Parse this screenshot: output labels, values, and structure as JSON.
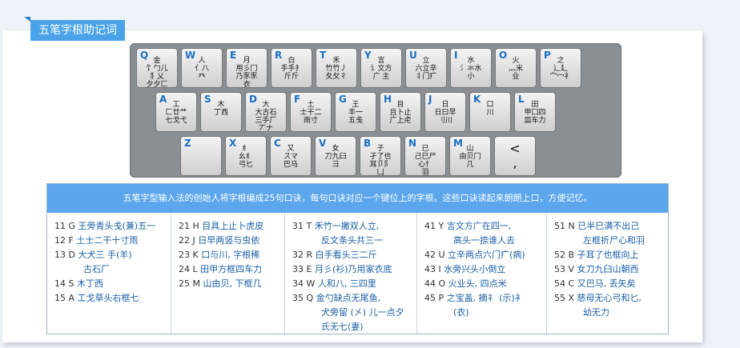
{
  "title": "五笔字根助记词",
  "keyboard": {
    "rows": [
      [
        {
          "letter": "Q",
          "caption": "金\n饣勹儿\n犭乂\n夕夕匚"
        },
        {
          "letter": "W",
          "caption": "人\n亻八\n癶"
        },
        {
          "letter": "E",
          "caption": "月\n用彡冂\n乃豕豕\n衣"
        },
        {
          "letter": "R",
          "caption": "白\n手手扌\n斤斤"
        },
        {
          "letter": "T",
          "caption": "禾\n竹竹丿\n夂攵彳"
        },
        {
          "letter": "Y",
          "caption": "言\n讠文方\n广 主"
        },
        {
          "letter": "U",
          "caption": "立\n六立辛\n丬门疒"
        },
        {
          "letter": "I",
          "caption": "水\n氵氺水\n小"
        },
        {
          "letter": "O",
          "caption": "火\n灬米\n业"
        },
        {
          "letter": "P",
          "caption": "之\n辶廴\n宀冖礻"
        }
      ],
      [
        {
          "letter": "A",
          "caption": "工\n匚廿艹\n七戈弋"
        },
        {
          "letter": "S",
          "caption": "木\n丁西"
        },
        {
          "letter": "D",
          "caption": "大\n大古石\n三手厂\n丆ナ"
        },
        {
          "letter": "F",
          "caption": "土\n士干二\n雨寸"
        },
        {
          "letter": "G",
          "caption": "王\n丰一\n五戋"
        },
        {
          "letter": "H",
          "caption": "目\n且卜止\n广上虍"
        },
        {
          "letter": "J",
          "caption": "日\n日曰早\n刂川"
        },
        {
          "letter": "K",
          "caption": "口\n川"
        },
        {
          "letter": "L",
          "caption": "田\n甲囗四\n皿车力"
        }
      ],
      [
        {
          "letter": "Z",
          "caption": ""
        },
        {
          "letter": "X",
          "caption": "纟\n幺纟\n弓匕"
        },
        {
          "letter": "C",
          "caption": "又\nスマ\n巴马"
        },
        {
          "letter": "V",
          "caption": "女\n刀九臼\n彐"
        },
        {
          "letter": "B",
          "caption": "子\n孑了也\n耳卩阝\n凵"
        },
        {
          "letter": "N",
          "caption": "已\n己巳尸\n心忄\n羽"
        },
        {
          "letter": "M",
          "caption": "山\n由贝冂\n几"
        },
        {
          "letter": "",
          "caption": "<\n,"
        }
      ]
    ]
  },
  "info": {
    "header": "五笔字型输入法的创始人将字根编成25句口诀，每句口诀对应一个键位上的字根。这些口诀读起来朗朗上口，方便记忆。",
    "columns": [
      [
        {
          "num": "11 G",
          "text": "王旁青头戋(兼)五一"
        },
        {
          "num": "12 F",
          "text": "土士二干十寸雨"
        },
        {
          "num": "13 D",
          "text": "大犬三 手(羊)"
        },
        {
          "num": "",
          "text": "古石厂"
        },
        {
          "num": "14 S",
          "text": "木丁西"
        },
        {
          "num": "15 A",
          "text": "工戈草头右框七"
        }
      ],
      [
        {
          "num": "21 H",
          "text": "目具上止卜虎皮"
        },
        {
          "num": "22 J",
          "text": "日早两竖与虫依"
        },
        {
          "num": "23 K",
          "text": "口与川, 字根稀"
        },
        {
          "num": "24 L",
          "text": "田甲方框四车力"
        },
        {
          "num": "25 M",
          "text": "山由贝, 下框几"
        }
      ],
      [
        {
          "num": "31 T",
          "text": "禾竹一撇双人立,"
        },
        {
          "num": "",
          "text": "反文条头共三一"
        },
        {
          "num": "32 R",
          "text": "白手看头三二斤"
        },
        {
          "num": "33 E",
          "text": "月彡(衫)乃用家衣底"
        },
        {
          "num": "34 W",
          "text": "人和八, 三四里"
        },
        {
          "num": "35 Q",
          "text": "金勺缺点无尾鱼,"
        },
        {
          "num": "",
          "text": "犬旁留 (㐅) 儿一点夕"
        },
        {
          "num": "",
          "text": "氏无七(妻)"
        }
      ],
      [
        {
          "num": "41 Y",
          "text": "言文方广在四一,"
        },
        {
          "num": "",
          "text": "高头一捺谁人去"
        },
        {
          "num": "42 U",
          "text": "立辛两点六门疒(病)"
        },
        {
          "num": "43 I",
          "text": "水旁兴头小倒立"
        },
        {
          "num": "44 O",
          "text": "火业头, 四点米"
        },
        {
          "num": "45 P",
          "text": "之宝盖, 摘礻 (示)衤"
        },
        {
          "num": "",
          "text": "(衣)"
        }
      ],
      [
        {
          "num": "51 N",
          "text": "已半巳满不出己"
        },
        {
          "num": "",
          "text": "左框折尸心和羽"
        },
        {
          "num": "52 B",
          "text": "子耳了也框向上"
        },
        {
          "num": "53 V",
          "text": "女刀九臼山朝西"
        },
        {
          "num": "54 C",
          "text": "又巴马, 丢矢矣"
        },
        {
          "num": "55 X",
          "text": "慈母无心弓和匕,"
        },
        {
          "num": "",
          "text": "幼无力"
        }
      ]
    ]
  }
}
